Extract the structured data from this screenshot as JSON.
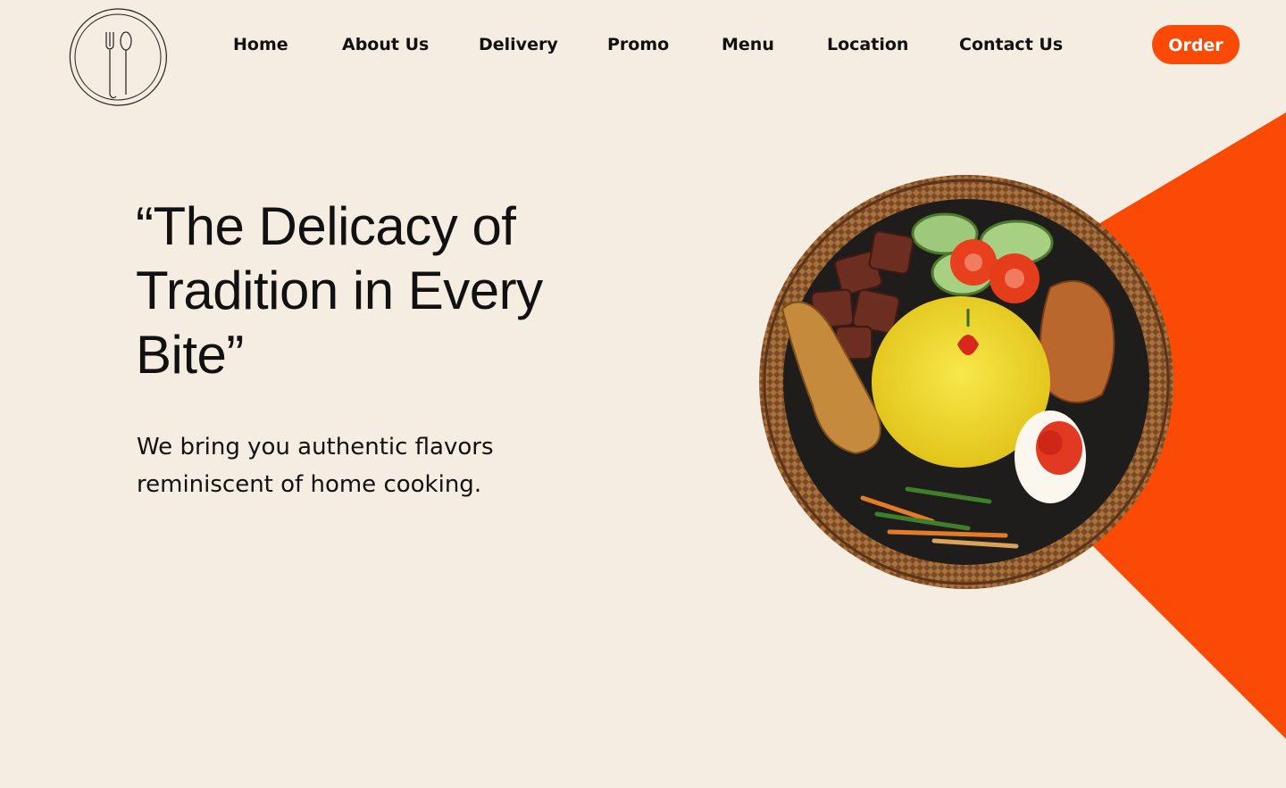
{
  "brand": {
    "logo_icon": "plate-fork-spoon-icon"
  },
  "nav": {
    "items": [
      {
        "label": "Home"
      },
      {
        "label": "About Us"
      },
      {
        "label": "Delivery"
      },
      {
        "label": "Promo"
      },
      {
        "label": "Menu"
      },
      {
        "label": "Location"
      },
      {
        "label": "Contact Us"
      }
    ],
    "order_label": "Order"
  },
  "hero": {
    "title": "“The Delicacy of Tradition in Every Bite”",
    "subtitle": "We bring you authentic flavors reminiscent of home cooking.",
    "image_icon": "rice-dish-plate-icon"
  },
  "colors": {
    "background": "#f5ede1",
    "accent": "#fb4a05",
    "text": "#111111"
  }
}
